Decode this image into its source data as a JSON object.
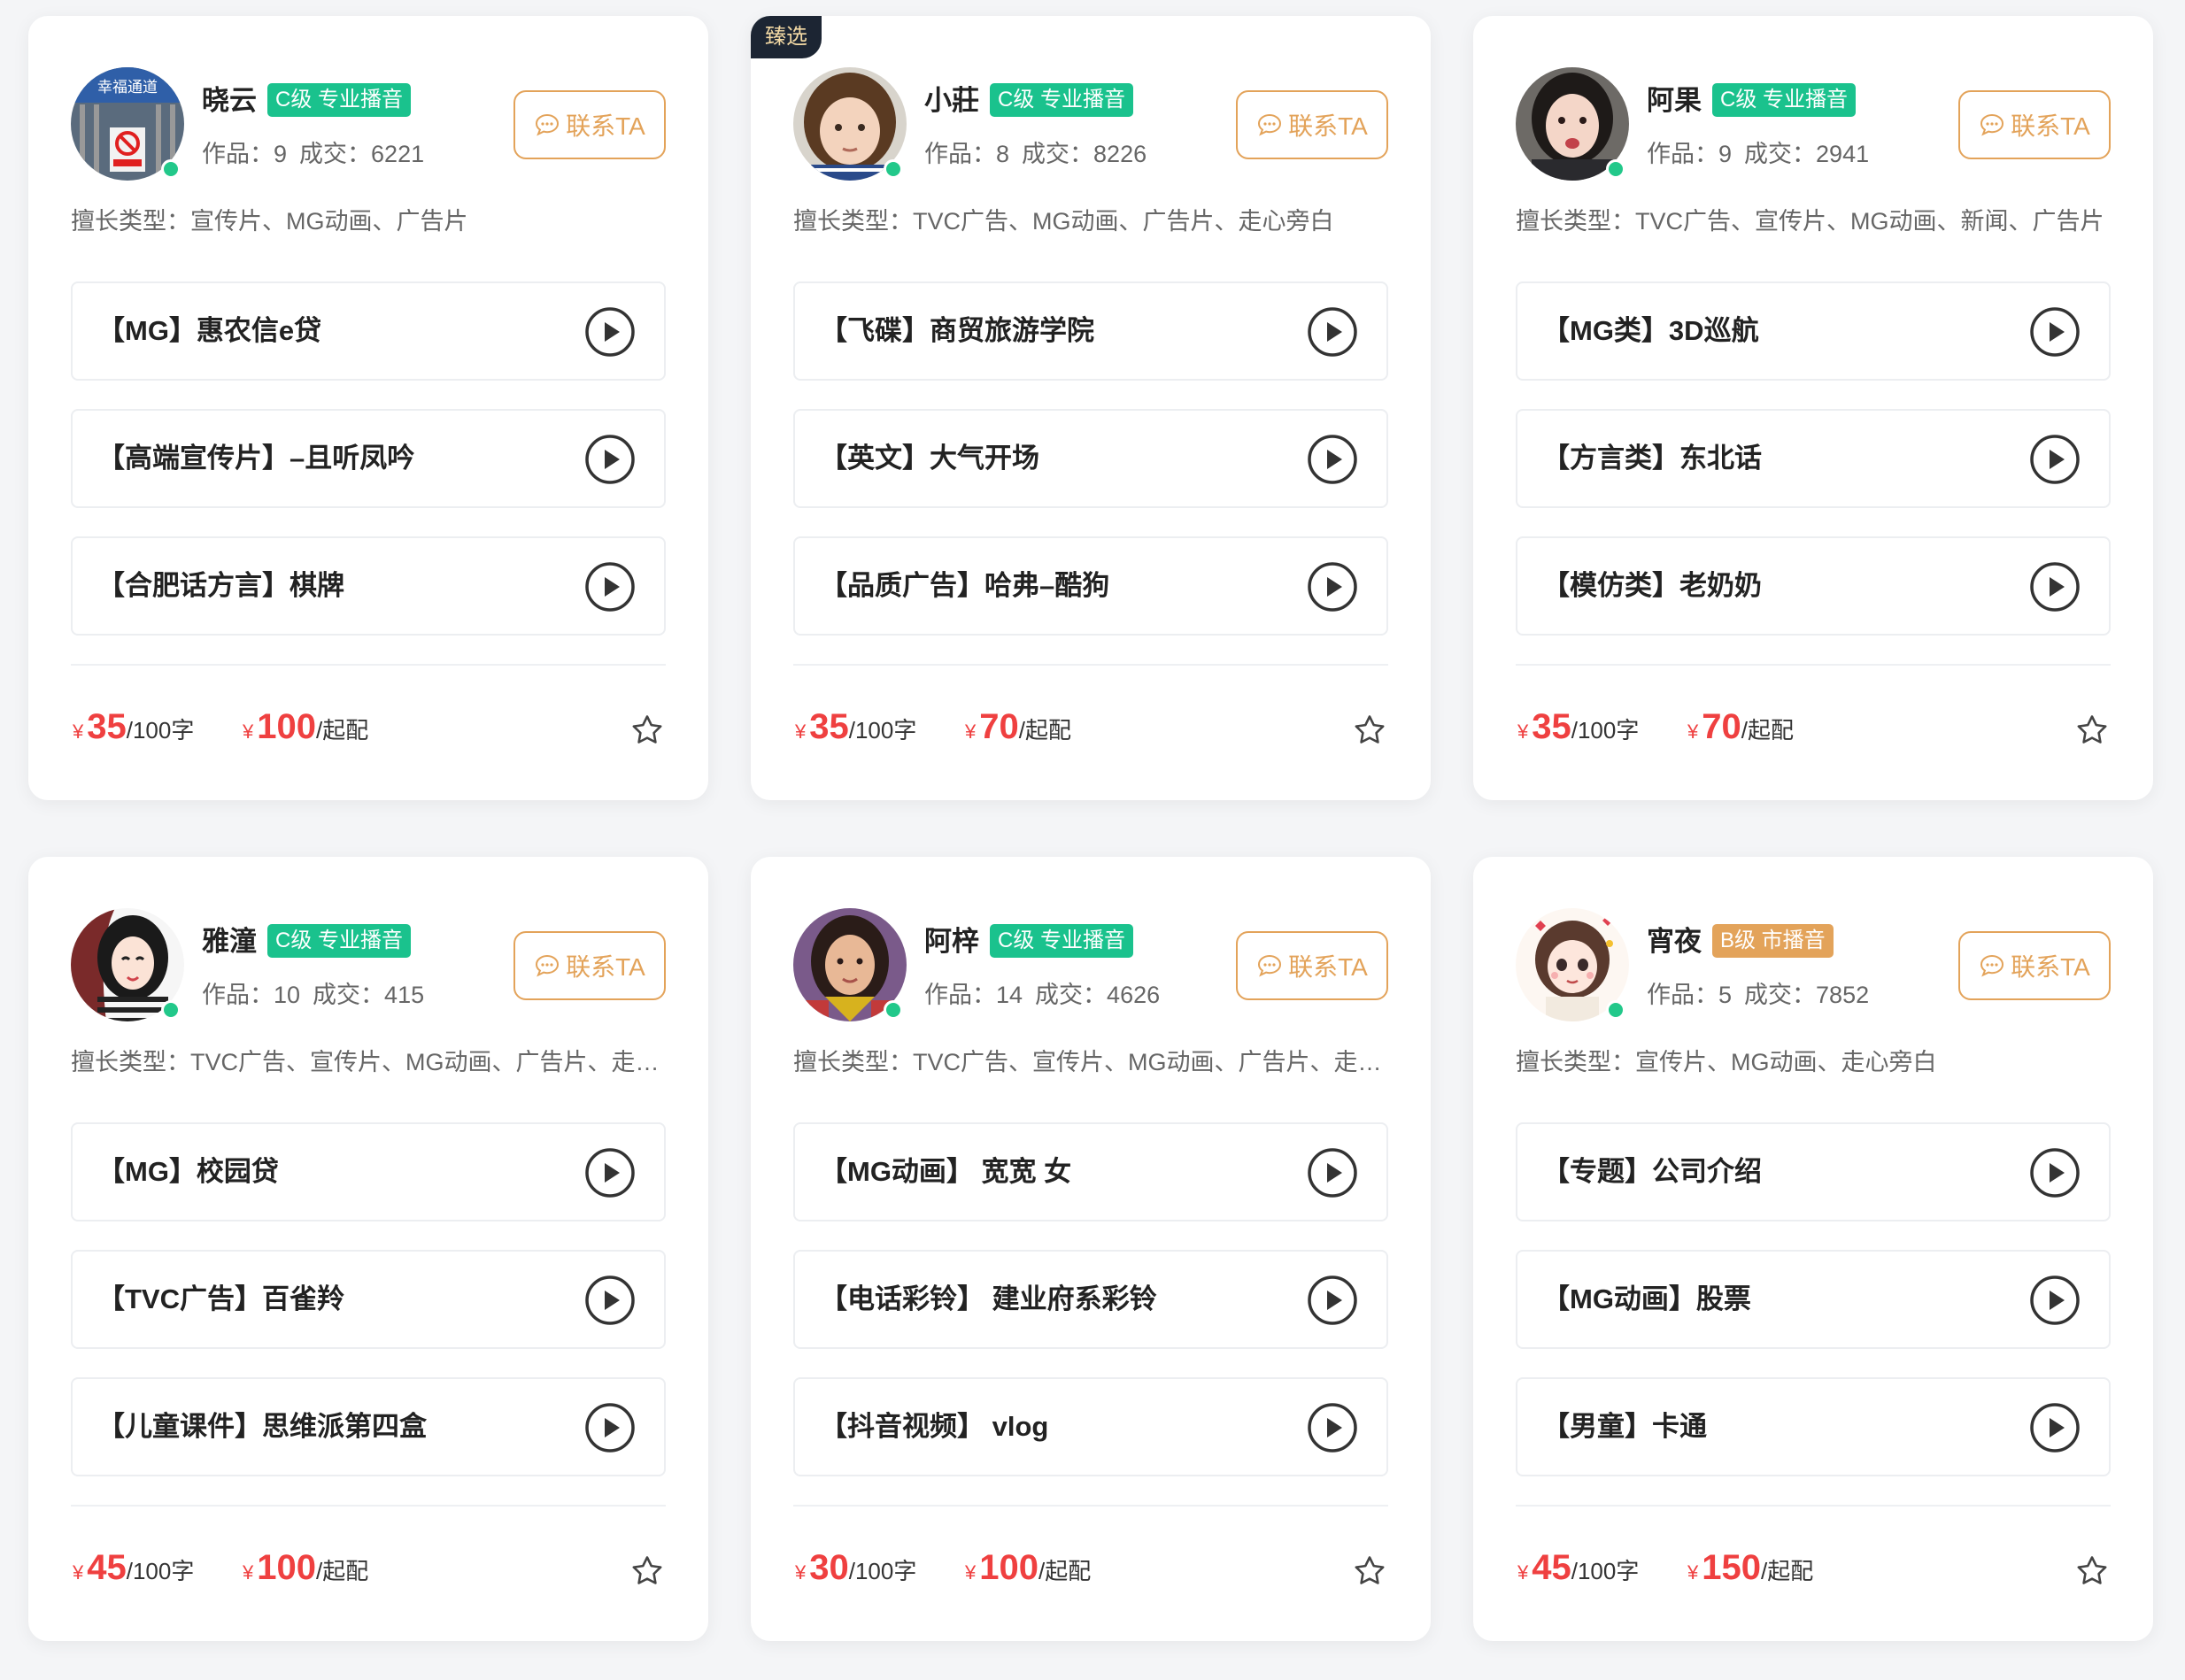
{
  "colors": {
    "accent": "#e3a35a",
    "price": "#ef4040",
    "level_green": "#1ac28d",
    "level_orange": "#e3a35a",
    "online": "#22c88a",
    "select_badge_bg": "#1c2533"
  },
  "cards": [
    {
      "name": "晓云",
      "level": "C级 专业播音",
      "level_color": "green",
      "works": "作品：9",
      "deals": "成交：6221",
      "contact": "联系TA",
      "skills": "擅长类型：宣传片、MG动画、广告片",
      "items": [
        "【MG】惠农信e贷",
        "【高端宣传片】–且听凤吟",
        "【合肥话方言】棋牌"
      ],
      "price1": {
        "currency": "¥",
        "value": "35",
        "unit": "/100字"
      },
      "price2": {
        "currency": "¥",
        "value": "100",
        "unit": "/起配"
      },
      "avatar_sign": "幸福通道"
    },
    {
      "badge": "臻选",
      "name": "小莊",
      "level": "C级 专业播音",
      "level_color": "green",
      "works": "作品：8",
      "deals": "成交：8226",
      "contact": "联系TA",
      "skills": "擅长类型：TVC广告、MG动画、广告片、走心旁白",
      "items": [
        "【飞碟】商贸旅游学院",
        "【英文】大气开场",
        "【品质广告】哈弗–酷狗"
      ],
      "price1": {
        "currency": "¥",
        "value": "35",
        "unit": "/100字"
      },
      "price2": {
        "currency": "¥",
        "value": "70",
        "unit": "/起配"
      }
    },
    {
      "name": "阿果",
      "level": "C级 专业播音",
      "level_color": "green",
      "works": "作品：9",
      "deals": "成交：2941",
      "contact": "联系TA",
      "skills": "擅长类型：TVC广告、宣传片、MG动画、新闻、广告片",
      "items": [
        "【MG类】3D巡航",
        "【方言类】东北话",
        "【模仿类】老奶奶"
      ],
      "price1": {
        "currency": "¥",
        "value": "35",
        "unit": "/100字"
      },
      "price2": {
        "currency": "¥",
        "value": "70",
        "unit": "/起配"
      }
    },
    {
      "name": "雅潼",
      "level": "C级 专业播音",
      "level_color": "green",
      "works": "作品：10",
      "deals": "成交：415",
      "contact": "联系TA",
      "skills": "擅长类型：TVC广告、宣传片、MG动画、广告片、走心旁白",
      "items": [
        "【MG】校园贷",
        "【TVC广告】百雀羚",
        "【儿童课件】思维派第四盒"
      ],
      "price1": {
        "currency": "¥",
        "value": "45",
        "unit": "/100字"
      },
      "price2": {
        "currency": "¥",
        "value": "100",
        "unit": "/起配"
      }
    },
    {
      "name": "阿梓",
      "level": "C级 专业播音",
      "level_color": "green",
      "works": "作品：14",
      "deals": "成交：4626",
      "contact": "联系TA",
      "skills": "擅长类型：TVC广告、宣传片、MG动画、广告片、走心旁白",
      "items": [
        "【MG动画】 宽宽 女",
        "【电话彩铃】 建业府系彩铃",
        "【抖音视频】 vlog"
      ],
      "price1": {
        "currency": "¥",
        "value": "30",
        "unit": "/100字"
      },
      "price2": {
        "currency": "¥",
        "value": "100",
        "unit": "/起配"
      }
    },
    {
      "name": "宵夜",
      "level": "B级 市播音",
      "level_color": "orange",
      "works": "作品：5",
      "deals": "成交：7852",
      "contact": "联系TA",
      "skills": "擅长类型：宣传片、MG动画、走心旁白",
      "items": [
        "【专题】公司介绍",
        "【MG动画】股票",
        "【男童】卡通"
      ],
      "price1": {
        "currency": "¥",
        "value": "45",
        "unit": "/100字"
      },
      "price2": {
        "currency": "¥",
        "value": "150",
        "unit": "/起配"
      }
    }
  ]
}
